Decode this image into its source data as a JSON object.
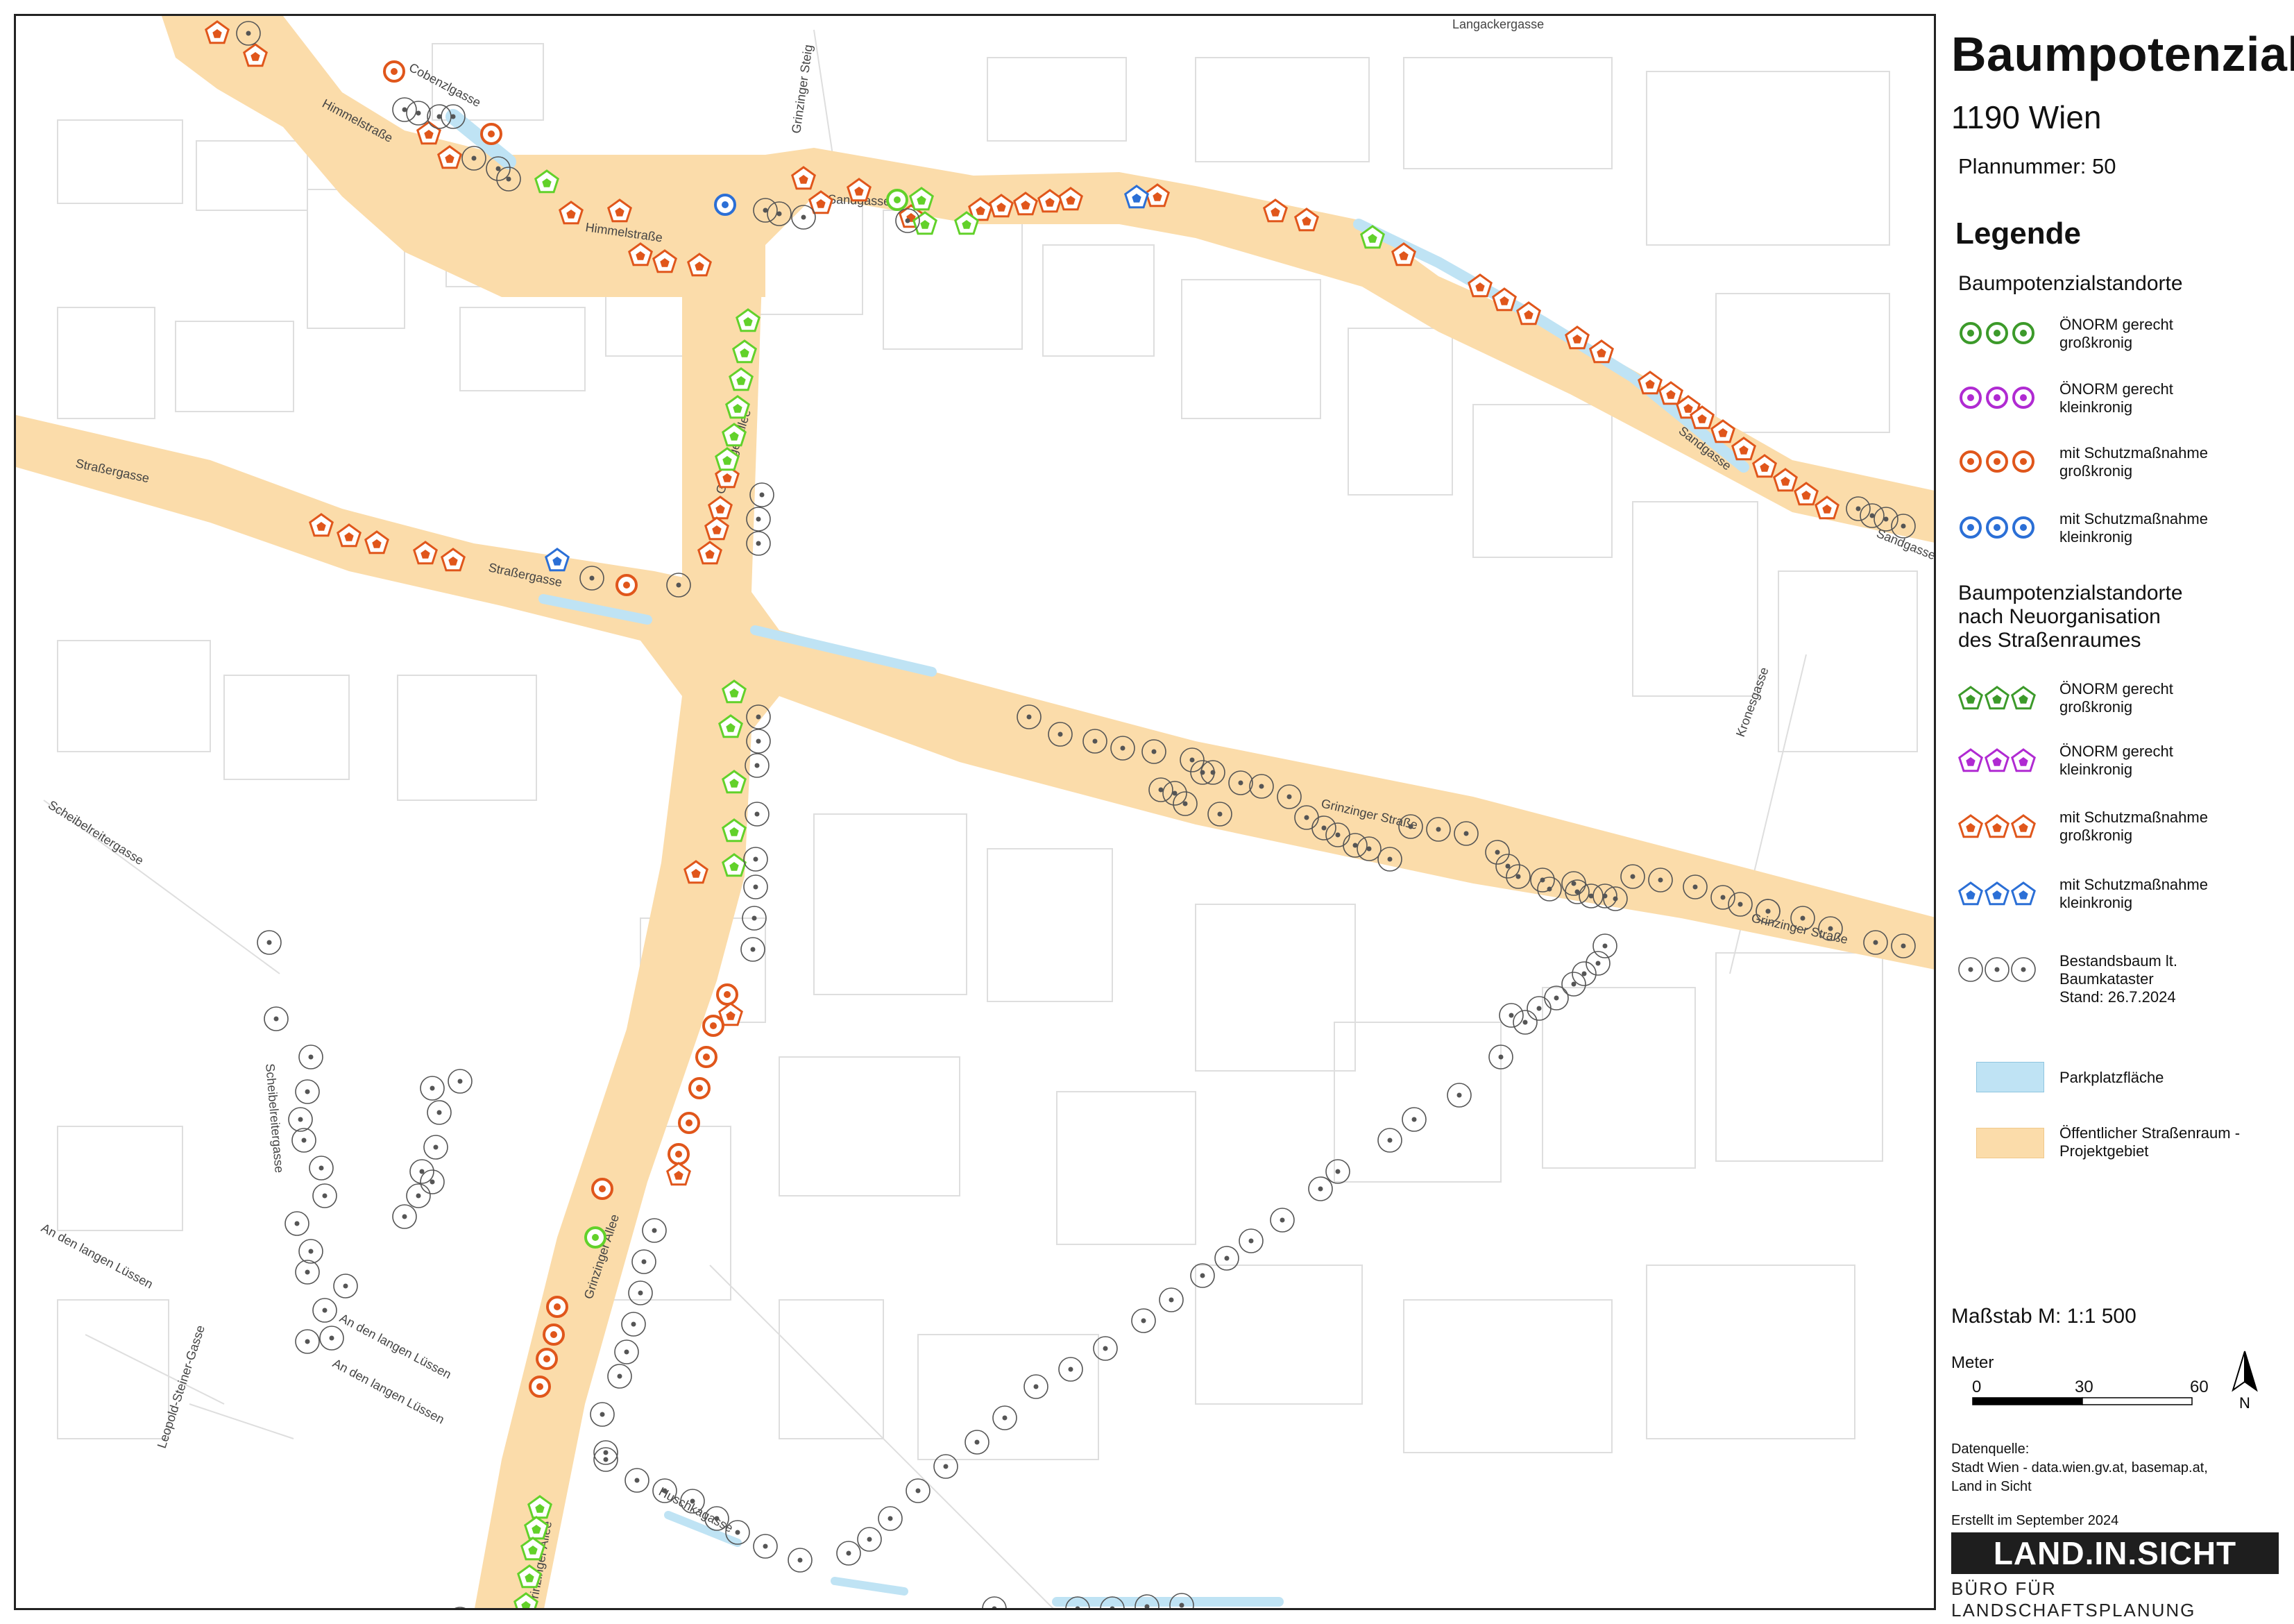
{
  "legend": {
    "title": "Baumpotenzial",
    "district": "1190 Wien",
    "plan_number": "Plannummer: 50",
    "heading": "Legende",
    "section_circles": "Baumpotenzialstandorte",
    "section_pentagons_l1": "Baumpotenzialstandorte",
    "section_pentagons_l2": "nach Neuorganisation",
    "section_pentagons_l3": "des Straßenraumes",
    "items_circles": [
      {
        "l1": "ÖNORM gerecht",
        "l2": "großkronig",
        "color": "#3c9a2a"
      },
      {
        "l1": "ÖNORM gerecht",
        "l2": "kleinkronig",
        "color": "#b02ad2"
      },
      {
        "l1": "mit Schutzmaßnahme",
        "l2": "großkronig",
        "color": "#e0561b"
      },
      {
        "l1": "mit Schutzmaßnahme",
        "l2": "kleinkronig",
        "color": "#2b6fd6"
      }
    ],
    "items_pentagons": [
      {
        "l1": "ÖNORM gerecht",
        "l2": "großkronig",
        "color": "#3c9a2a"
      },
      {
        "l1": "ÖNORM gerecht",
        "l2": "kleinkronig",
        "color": "#b02ad2"
      },
      {
        "l1": "mit Schutzmaßnahme",
        "l2": "großkronig",
        "color": "#e0561b"
      },
      {
        "l1": "mit Schutzmaßnahme",
        "l2": "kleinkronig",
        "color": "#2b6fd6"
      }
    ],
    "existing_l1": "Bestandsbaum lt.",
    "existing_l2": "Baumkataster",
    "existing_l3": "Stand: 26.7.2024",
    "parking": "Parkplatzfläche",
    "public_space_l1": "Öffentlicher Straßenraum -",
    "public_space_l2": "Projektgebiet",
    "scale": "Maßstab M: 1:1 500",
    "meter": "Meter",
    "ticks": [
      "0",
      "30",
      "60"
    ],
    "north": "N",
    "data_source_l1": "Datenquelle:",
    "data_source_l2": "Stadt Wien - data.wien.gv.at, basemap.at,",
    "data_source_l3": "Land in Sicht",
    "created": "Erstellt im September 2024",
    "logo": "LAND.IN.SICHT",
    "logo_sub": "BÜRO FÜR LANDSCHAFTSPLANUNG"
  },
  "colors": {
    "green": "#3c9a2a",
    "green_light": "#62d12a",
    "purple": "#b02ad2",
    "orange": "#e0561b",
    "blue": "#2b6fd6",
    "grey": "#666666",
    "street": "#fbdcaa",
    "parking": "#bfe3f4"
  },
  "street_labels": [
    "Langackergasse",
    "Cobenzlgasse",
    "Himmelstraße",
    "Grinzinger Steig",
    "Sandgasse",
    "Himmelstraße",
    "Straßergasse",
    "Straßergasse",
    "Grinzinger Allee",
    "Sandgasse",
    "Sandgasse",
    "Kronesgasse",
    "Grinzinger Straße",
    "Grinzinger Straße",
    "Scheibelreitergasse",
    "Scheibelreitergasse",
    "An den langen Lüssen",
    "An den langen Lüssen",
    "An den langen Lüssen",
    "Leopold-Steiner-Gasse",
    "Grinzinger Allee",
    "Huschkagasse",
    "Grinzinger Allee"
  ]
}
